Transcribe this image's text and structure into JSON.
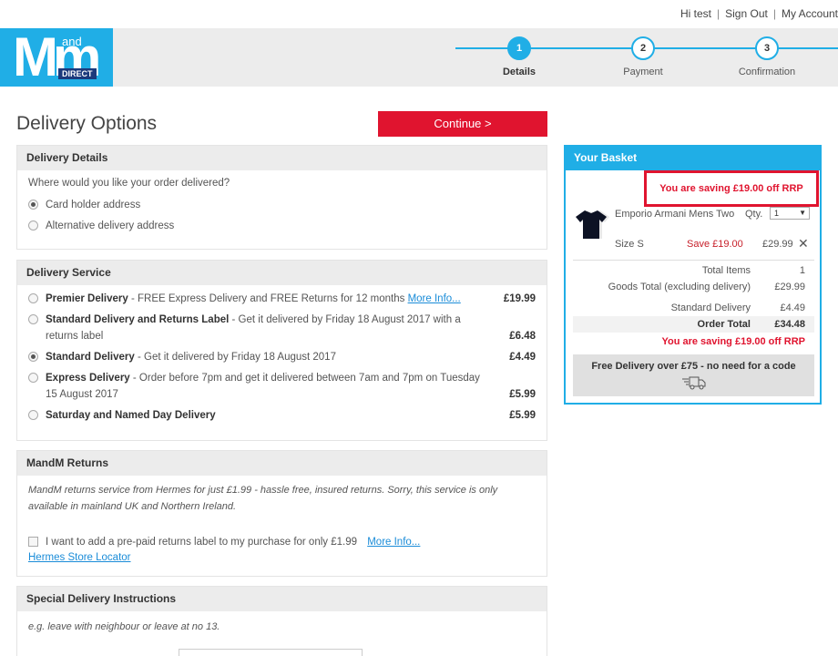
{
  "account": {
    "greeting": "Hi test",
    "sign_out": "Sign Out",
    "my_account": "My Account"
  },
  "logo": {
    "main": "Mm",
    "and": "and",
    "direct": "DIRECT"
  },
  "steps": [
    {
      "num": "1",
      "label": "Details"
    },
    {
      "num": "2",
      "label": "Payment"
    },
    {
      "num": "3",
      "label": "Confirmation"
    }
  ],
  "page_title": "Delivery Options",
  "continue_label": "Continue >",
  "delivery_details": {
    "heading": "Delivery Details",
    "question": "Where would you like your order delivered?",
    "options": [
      "Card holder address",
      "Alternative delivery address"
    ],
    "selected": "Card holder address"
  },
  "delivery_service": {
    "heading": "Delivery Service",
    "options": [
      {
        "name": "Premier Delivery",
        "desc": " - FREE Express Delivery and FREE Returns for 12 months ",
        "link": "More Info...",
        "price": "£19.99"
      },
      {
        "name": "Standard Delivery and Returns Label",
        "desc": " - Get it delivered by Friday 18 August 2017 with a returns label",
        "link": "",
        "price": "£6.48"
      },
      {
        "name": "Standard Delivery",
        "desc": " - Get it delivered by Friday 18 August 2017",
        "link": "",
        "price": "£4.49"
      },
      {
        "name": "Express Delivery",
        "desc": " - Order before 7pm and get it delivered between 7am and 7pm on Tuesday 15 August 2017",
        "link": "",
        "price": "£5.99"
      },
      {
        "name": "Saturday and Named Day Delivery",
        "desc": "",
        "link": "",
        "price": "£5.99"
      }
    ],
    "selected": "Standard Delivery"
  },
  "returns": {
    "heading": "MandM Returns",
    "info": "MandM returns service from Hermes for just £1.99 - hassle free, insured returns. Sorry, this service is only available in mainland UK and Northern Ireland.",
    "checkbox_label": "I want to add a pre-paid returns label to my purchase for only £1.99",
    "more_info": "More Info...",
    "store_locator": "Hermes Store Locator"
  },
  "special": {
    "heading": "Special Delivery Instructions",
    "hint": "e.g. leave with neighbour or leave at no 13."
  },
  "basket": {
    "heading": "Your Basket",
    "saving_banner": "You are saving £19.00 off RRP",
    "item": {
      "name": "Emporio Armani Mens Two",
      "qty_label": "Qty.",
      "qty": "1",
      "size": "Size  S",
      "save": "Save  £19.00",
      "price": "£29.99"
    },
    "totals": [
      {
        "label": "Total Items",
        "value": "1"
      },
      {
        "label": "Goods Total (excluding delivery)",
        "value": "£29.99"
      },
      {
        "label": "Standard Delivery",
        "value": "£4.49"
      },
      {
        "label": "Order Total",
        "value": "£34.48"
      }
    ],
    "saving_footer": "You are saving £19.00 off RRP",
    "free_delivery": "Free Delivery over £75 - no need for a code"
  },
  "colors": {
    "brand_blue": "#20aee6",
    "accent_red": "#e0142f",
    "panel_grey": "#ececec"
  }
}
